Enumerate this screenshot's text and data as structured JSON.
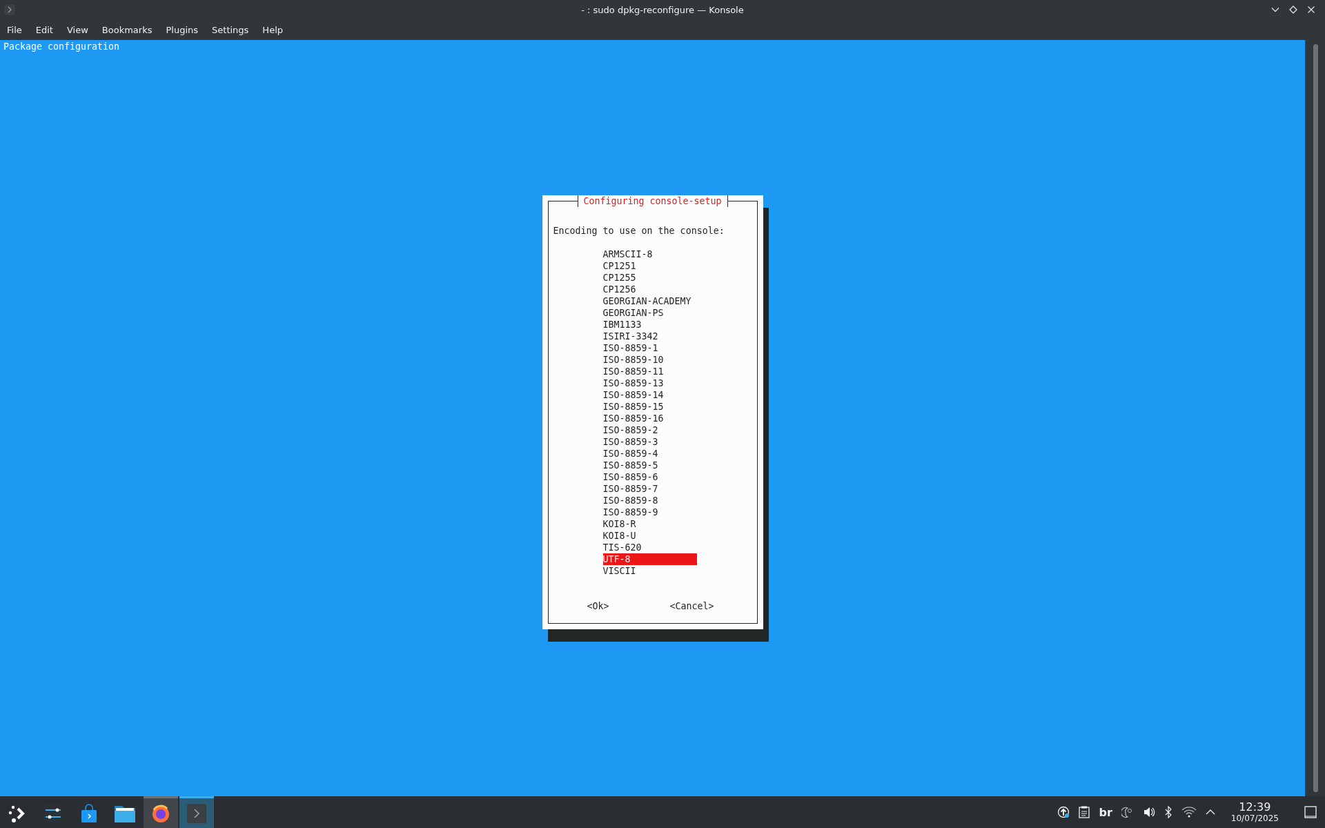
{
  "window": {
    "title": "- : sudo dpkg-reconfigure — Konsole"
  },
  "menu": [
    "File",
    "Edit",
    "View",
    "Bookmarks",
    "Plugins",
    "Settings",
    "Help"
  ],
  "terminal": {
    "header": "Package configuration"
  },
  "dialog": {
    "title": "Configuring console-setup",
    "prompt": "Encoding to use on the console:",
    "options": [
      {
        "label": "ARMSCII-8",
        "selected": false
      },
      {
        "label": "CP1251",
        "selected": false
      },
      {
        "label": "CP1255",
        "selected": false
      },
      {
        "label": "CP1256",
        "selected": false
      },
      {
        "label": "GEORGIAN-ACADEMY",
        "selected": false
      },
      {
        "label": "GEORGIAN-PS",
        "selected": false
      },
      {
        "label": "IBM1133",
        "selected": false
      },
      {
        "label": "ISIRI-3342",
        "selected": false
      },
      {
        "label": "ISO-8859-1",
        "selected": false
      },
      {
        "label": "ISO-8859-10",
        "selected": false
      },
      {
        "label": "ISO-8859-11",
        "selected": false
      },
      {
        "label": "ISO-8859-13",
        "selected": false
      },
      {
        "label": "ISO-8859-14",
        "selected": false
      },
      {
        "label": "ISO-8859-15",
        "selected": false
      },
      {
        "label": "ISO-8859-16",
        "selected": false
      },
      {
        "label": "ISO-8859-2",
        "selected": false
      },
      {
        "label": "ISO-8859-3",
        "selected": false
      },
      {
        "label": "ISO-8859-4",
        "selected": false
      },
      {
        "label": "ISO-8859-5",
        "selected": false
      },
      {
        "label": "ISO-8859-6",
        "selected": false
      },
      {
        "label": "ISO-8859-7",
        "selected": false
      },
      {
        "label": "ISO-8859-8",
        "selected": false
      },
      {
        "label": "ISO-8859-9",
        "selected": false
      },
      {
        "label": "KOI8-R",
        "selected": false
      },
      {
        "label": "KOI8-U",
        "selected": false
      },
      {
        "label": "TIS-620",
        "selected": false
      },
      {
        "label": "UTF-8",
        "selected": true
      },
      {
        "label": "VISCII",
        "selected": false
      }
    ],
    "buttons": [
      "<Ok>",
      "<Cancel>"
    ]
  },
  "taskbar": {
    "items": [
      {
        "kind": "app-menu",
        "running": false,
        "selected": false
      },
      {
        "kind": "settings",
        "running": false,
        "selected": false
      },
      {
        "kind": "store",
        "running": false,
        "selected": false
      },
      {
        "kind": "files",
        "running": false,
        "selected": false
      },
      {
        "kind": "browser",
        "running": true,
        "selected": false
      },
      {
        "kind": "terminal",
        "running": true,
        "selected": true
      }
    ]
  },
  "tray": {
    "keyboard_layout": "br",
    "time": "12:39",
    "date": "10/07/2025"
  }
}
